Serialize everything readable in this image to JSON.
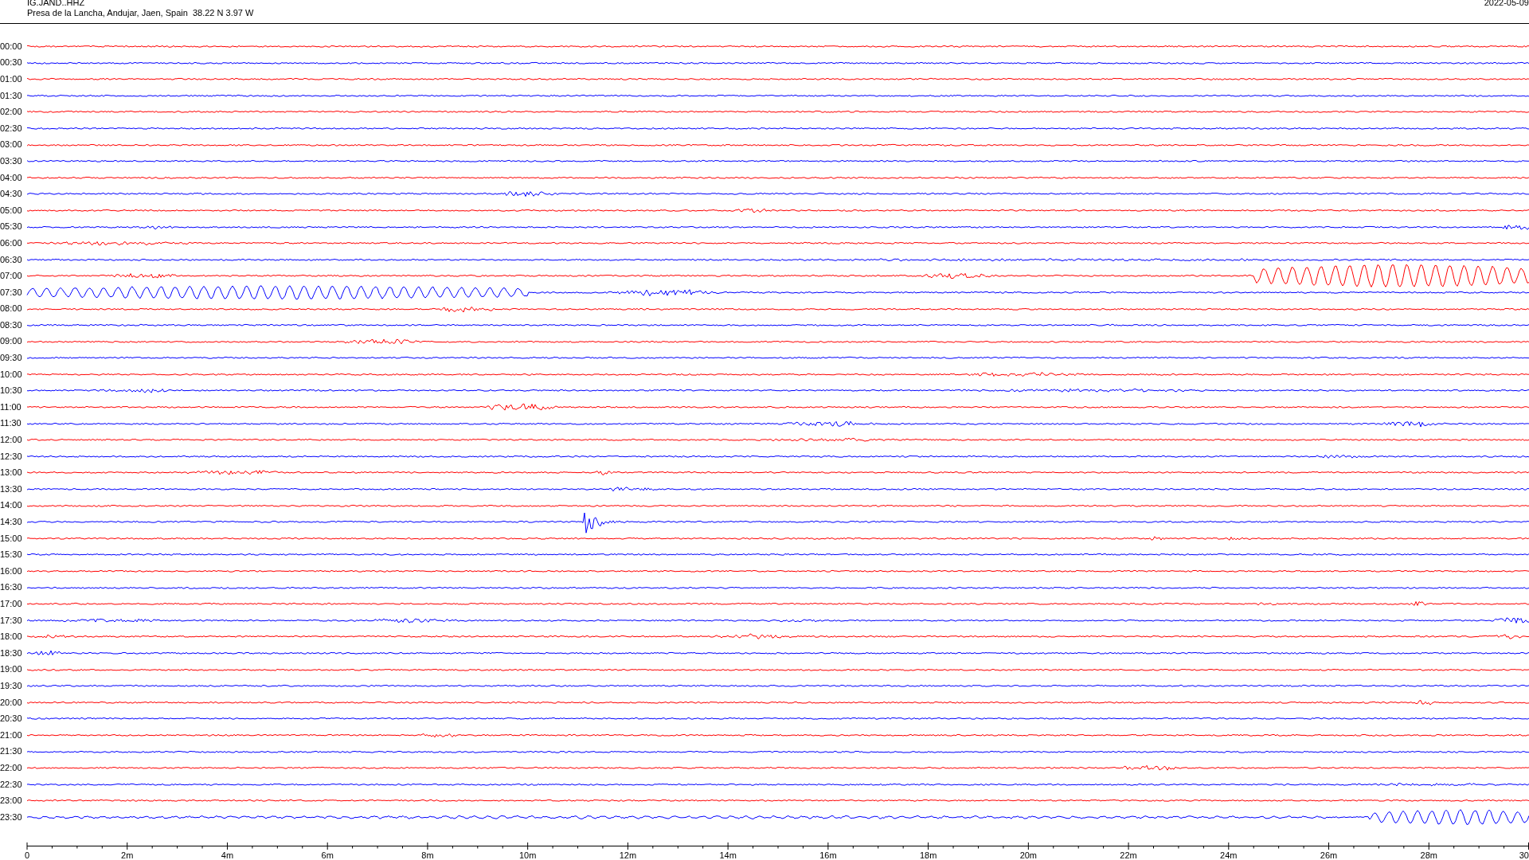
{
  "header": {
    "channel": "IG.JAND..HHZ",
    "station": "Presa de la Lancha, Andujar, Jaen, Spain  38.22 N 3.97 W",
    "date": "2022-05-09"
  },
  "rows": [
    {
      "time": "00:00",
      "color": "#ff0000"
    },
    {
      "time": "00:30",
      "color": "#0000ff"
    },
    {
      "time": "01:00",
      "color": "#ff0000"
    },
    {
      "time": "01:30",
      "color": "#0000ff"
    },
    {
      "time": "02:00",
      "color": "#ff0000"
    },
    {
      "time": "02:30",
      "color": "#0000ff"
    },
    {
      "time": "03:00",
      "color": "#ff0000"
    },
    {
      "time": "03:30",
      "color": "#0000ff"
    },
    {
      "time": "04:00",
      "color": "#ff0000"
    },
    {
      "time": "04:30",
      "color": "#0000ff"
    },
    {
      "time": "05:00",
      "color": "#ff0000"
    },
    {
      "time": "05:30",
      "color": "#0000ff"
    },
    {
      "time": "06:00",
      "color": "#ff0000"
    },
    {
      "time": "06:30",
      "color": "#0000ff"
    },
    {
      "time": "07:00",
      "color": "#ff0000"
    },
    {
      "time": "07:30",
      "color": "#0000ff"
    },
    {
      "time": "08:00",
      "color": "#ff0000"
    },
    {
      "time": "08:30",
      "color": "#0000ff"
    },
    {
      "time": "09:00",
      "color": "#ff0000"
    },
    {
      "time": "09:30",
      "color": "#0000ff"
    },
    {
      "time": "10:00",
      "color": "#ff0000"
    },
    {
      "time": "10:30",
      "color": "#0000ff"
    },
    {
      "time": "11:00",
      "color": "#ff0000"
    },
    {
      "time": "11:30",
      "color": "#0000ff"
    },
    {
      "time": "12:00",
      "color": "#ff0000"
    },
    {
      "time": "12:30",
      "color": "#0000ff"
    },
    {
      "time": "13:00",
      "color": "#ff0000"
    },
    {
      "time": "13:30",
      "color": "#0000ff"
    },
    {
      "time": "14:00",
      "color": "#ff0000"
    },
    {
      "time": "14:30",
      "color": "#0000ff"
    },
    {
      "time": "15:00",
      "color": "#ff0000"
    },
    {
      "time": "15:30",
      "color": "#0000ff"
    },
    {
      "time": "16:00",
      "color": "#ff0000"
    },
    {
      "time": "16:30",
      "color": "#0000ff"
    },
    {
      "time": "17:00",
      "color": "#ff0000"
    },
    {
      "time": "17:30",
      "color": "#0000ff"
    },
    {
      "time": "18:00",
      "color": "#ff0000"
    },
    {
      "time": "18:30",
      "color": "#0000ff"
    },
    {
      "time": "19:00",
      "color": "#ff0000"
    },
    {
      "time": "19:30",
      "color": "#0000ff"
    },
    {
      "time": "20:00",
      "color": "#ff0000"
    },
    {
      "time": "20:30",
      "color": "#0000ff"
    },
    {
      "time": "21:00",
      "color": "#ff0000"
    },
    {
      "time": "21:30",
      "color": "#0000ff"
    },
    {
      "time": "22:00",
      "color": "#ff0000"
    },
    {
      "time": "22:30",
      "color": "#0000ff"
    },
    {
      "time": "23:00",
      "color": "#ff0000"
    },
    {
      "time": "23:30",
      "color": "#0000ff"
    }
  ],
  "axis": {
    "labels": [
      "0",
      "2m",
      "4m",
      "6m",
      "8m",
      "10m",
      "12m",
      "14m",
      "16m",
      "18m",
      "20m",
      "22m",
      "24m",
      "26m",
      "28m",
      "30"
    ]
  }
}
